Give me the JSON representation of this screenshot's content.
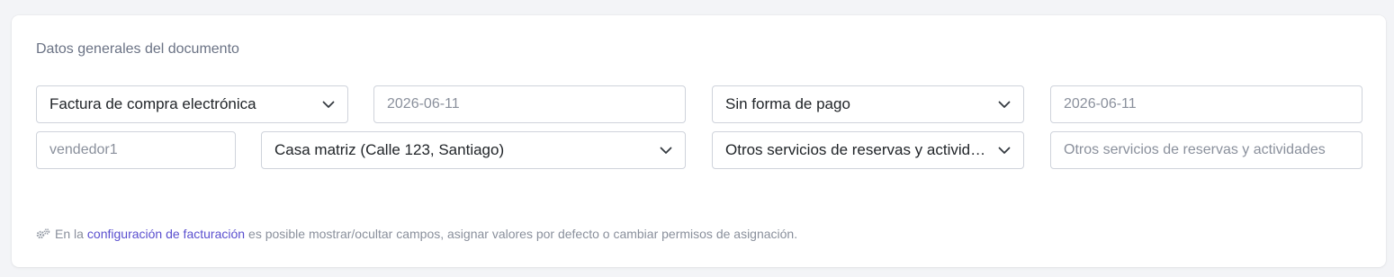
{
  "section": {
    "title": "Datos generales del documento"
  },
  "row1": {
    "document_type": "Factura de compra electrónica",
    "issue_date": "2026-06-11",
    "payment_method": "Sin forma de pago",
    "due_date": "2026-06-11"
  },
  "row2": {
    "seller": "vendedor1",
    "branch": "Casa matriz (Calle 123, Santiago)",
    "activity_select": "Otros servicios de reservas y actividades",
    "activity_text": "Otros servicios de reservas y actividades"
  },
  "footer": {
    "prefix": "En la",
    "link": "configuración de facturación",
    "suffix": "es posible mostrar/ocultar campos, asignar valores por defecto o cambiar permisos de asignación."
  },
  "icons": {
    "chevron": "chevron-down-icon",
    "settings": "gears-icon"
  },
  "colors": {
    "link": "#5a4fcf",
    "muted_text": "#8a909c",
    "border": "#cfd3db"
  }
}
